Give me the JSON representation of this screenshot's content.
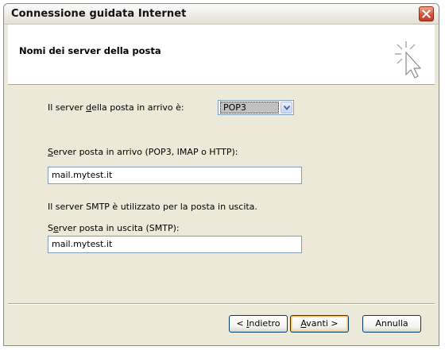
{
  "window": {
    "title": "Connessione guidata Internet"
  },
  "header": {
    "title": "Nomi dei server della posta",
    "icon": "wizard-cursor-sparkle-icon"
  },
  "form": {
    "incoming_type_label": {
      "pre": "Il server ",
      "mnemonic": "d",
      "post": "ella posta in arrivo è:"
    },
    "incoming_type_value": "POP3",
    "incoming_server_label": {
      "pre": "",
      "mnemonic": "S",
      "post": "erver posta in arrivo (POP3, IMAP o HTTP):"
    },
    "incoming_server_value": "mail.mytest.it",
    "smtp_info": "Il server SMTP è utilizzato per la posta in uscita.",
    "outgoing_server_label": {
      "pre": "S",
      "mnemonic": "e",
      "post": "rver posta in uscita (SMTP):"
    },
    "outgoing_server_value": "mail.mytest.it"
  },
  "buttons": {
    "back": {
      "pre": "< ",
      "mnemonic": "I",
      "post": "ndietro"
    },
    "next": {
      "pre": "",
      "mnemonic": "A",
      "post": "vanti >"
    },
    "cancel": "Annulla"
  },
  "colors": {
    "dialog_bg": "#ece9d8",
    "close_button": "#d8533a",
    "input_border": "#7f9db9",
    "default_button_focus": "#f5c561"
  }
}
